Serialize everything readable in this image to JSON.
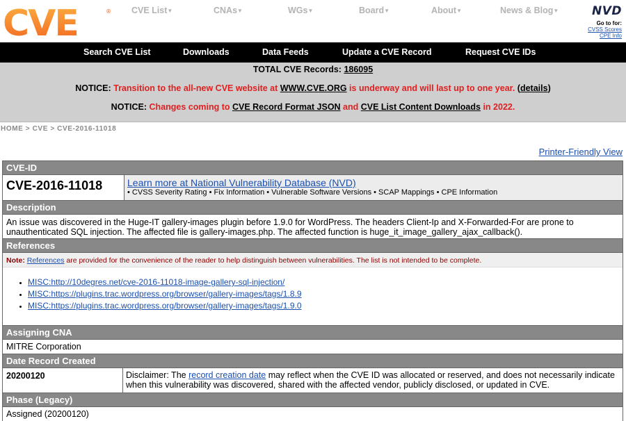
{
  "header": {
    "logo_text": "CVE",
    "nav": [
      {
        "label": "CVE List"
      },
      {
        "label": "CNAs"
      },
      {
        "label": "WGs"
      },
      {
        "label": "Board"
      },
      {
        "label": "About"
      },
      {
        "label": "News & Blog"
      }
    ],
    "nvd": {
      "logo": "NVD",
      "goto": "Go to for:",
      "cvss": "CVSS Scores",
      "cpe": "CPE Info"
    }
  },
  "menubar": {
    "items": [
      "Search CVE List",
      "Downloads",
      "Data Feeds",
      "Update a CVE Record",
      "Request CVE IDs"
    ]
  },
  "notice": {
    "total_label": "TOTAL CVE Records: ",
    "total_value": "186095",
    "n1_label": "NOTICE: ",
    "n1_red1": "Transition to the all-new CVE website at ",
    "n1_link": "WWW.CVE.ORG",
    "n1_red2": " is underway and will last up to one year. ",
    "n1_details_open": "(",
    "n1_details": "details",
    "n1_details_close": ")",
    "n2_label": "NOTICE: ",
    "n2_red1": "Changes coming to ",
    "n2_link1": "CVE Record Format JSON",
    "n2_red2": " and ",
    "n2_link2": "CVE List Content Downloads",
    "n2_red3": " in 2022."
  },
  "breadcrumb": "HOME > CVE > CVE-2016-11018",
  "printer_link": "Printer-Friendly View",
  "record": {
    "id_header": "CVE-ID",
    "id": "CVE-2016-11018",
    "nvd_link": "Learn more at National Vulnerability Database (NVD)",
    "nvd_features": "• CVSS Severity Rating • Fix Information • Vulnerable Software Versions • SCAP Mappings • CPE Information",
    "description_header": "Description",
    "description": "An issue was discovered in the Huge-IT gallery-images plugin before 1.9.0 for WordPress. The headers Client-Ip and X-Forwarded-For are prone to unauthenticated SQL injection. The affected file is gallery-images.php. The affected function is huge_it_image_gallery_ajax_callback().",
    "references_header": "References",
    "note_label": "Note: ",
    "note_link": "References",
    "note_text": " are provided for the convenience of the reader to help distinguish between vulnerabilities. The list is not intended to be complete.",
    "references": [
      "MISC:http://10degres.net/cve-2016-11018-image-gallery-sql-injection/",
      "MISC:https://plugins.trac.wordpress.org/browser/gallery-images/tags/1.8.9",
      "MISC:https://plugins.trac.wordpress.org/browser/gallery-images/tags/1.9.0"
    ],
    "cna_header": "Assigning CNA",
    "cna": "MITRE Corporation",
    "date_header": "Date Record Created",
    "date": "20200120",
    "disclaimer_pre": "Disclaimer: The ",
    "disclaimer_link": "record creation date",
    "disclaimer_post": " may reflect when the CVE ID was allocated or reserved, and does not necessarily indicate when this vulnerability was discovered, shared with the affected vendor, publicly disclosed, or updated in CVE.",
    "phase_header": "Phase (Legacy)",
    "phase": "Assigned (20200120)"
  },
  "colors": {
    "logo_orange": "#f7941d",
    "notice_red": "#e02020",
    "header_gray": "#888888",
    "link_blue": "#1b4fae"
  }
}
